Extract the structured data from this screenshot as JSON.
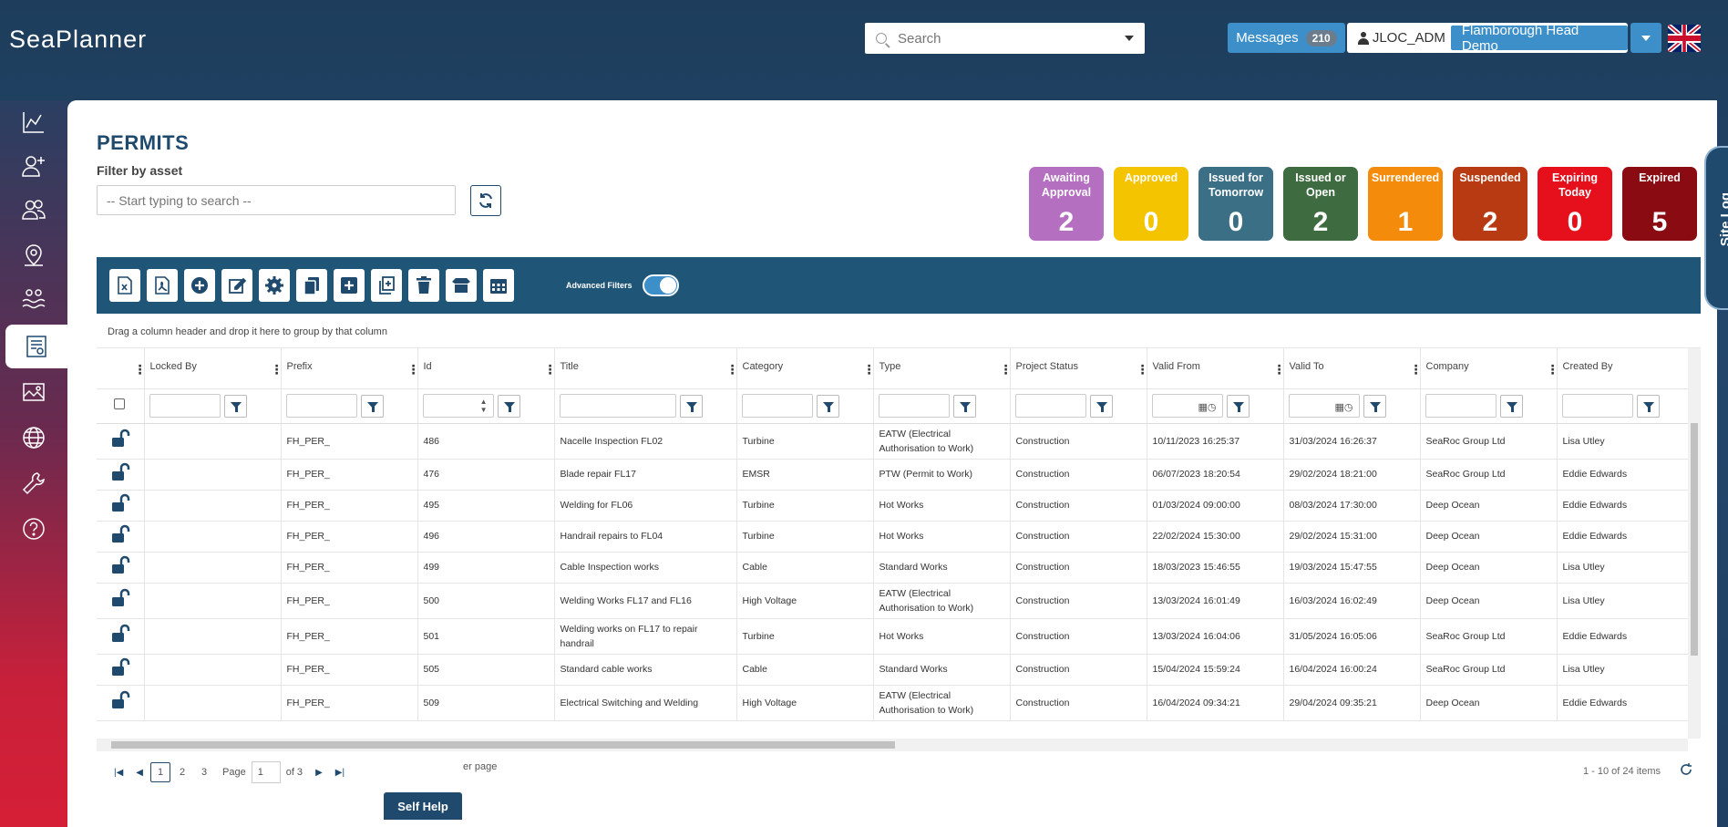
{
  "app": {
    "logo": "SeaPlanner"
  },
  "header": {
    "search_placeholder": "Search",
    "messages_label": "Messages",
    "messages_count": "210",
    "username": "JLOC_ADM",
    "site_name": "Flamborough Head Demo"
  },
  "sidebar": {
    "items": [
      {
        "icon": "chart-line-icon"
      },
      {
        "icon": "add-user-icon"
      },
      {
        "icon": "users-icon"
      },
      {
        "icon": "map-pin-icon"
      },
      {
        "icon": "waves-icon"
      },
      {
        "icon": "permits-icon",
        "active": true
      },
      {
        "icon": "image-icon"
      },
      {
        "icon": "globe-icon"
      },
      {
        "icon": "wrench-icon"
      },
      {
        "icon": "help-icon"
      }
    ]
  },
  "page": {
    "title": "PERMITS",
    "filter_label": "Filter by asset",
    "asset_placeholder": "-- Start typing to search --"
  },
  "status_tiles": [
    {
      "label": "Awaiting Approval",
      "count": "2",
      "color": "#b46fc0"
    },
    {
      "label": "Approved",
      "count": "0",
      "color": "#f5c400"
    },
    {
      "label": "Issued for Tomorrow",
      "count": "0",
      "color": "#3b6f86"
    },
    {
      "label": "Issued or Open",
      "count": "2",
      "color": "#3e6b3f"
    },
    {
      "label": "Surrendered",
      "count": "1",
      "color": "#f58b0a"
    },
    {
      "label": "Suspended",
      "count": "2",
      "color": "#b83a12"
    },
    {
      "label": "Expiring Today",
      "count": "0",
      "color": "#e5101c"
    },
    {
      "label": "Expired",
      "count": "5",
      "color": "#8a0b12"
    }
  ],
  "site_log_label": "Site Log",
  "toolbar": {
    "advanced_filters_label": "Advanced Filters"
  },
  "grid": {
    "group_hint": "Drag a column header and drop it here to group by that column",
    "columns": [
      "Locked By",
      "Prefix",
      "Id",
      "Title",
      "Category",
      "Type",
      "Project Status",
      "Valid From",
      "Valid To",
      "Company",
      "Created By"
    ],
    "rows": [
      {
        "locked_by": "",
        "prefix": "FH_PER_",
        "id": "486",
        "title": "Nacelle Inspection FL02",
        "category": "Turbine",
        "type": "EATW (Electrical Authorisation to Work)",
        "status": "Construction",
        "valid_from": "10/11/2023 16:25:37",
        "valid_to": "31/03/2024 16:26:37",
        "company": "SeaRoc Group Ltd",
        "created_by": "Lisa Utley"
      },
      {
        "locked_by": "",
        "prefix": "FH_PER_",
        "id": "476",
        "title": "Blade repair FL17",
        "category": "EMSR",
        "type": "PTW (Permit to Work)",
        "status": "Construction",
        "valid_from": "06/07/2023 18:20:54",
        "valid_to": "29/02/2024 18:21:00",
        "company": "SeaRoc Group Ltd",
        "created_by": "Eddie Edwards"
      },
      {
        "locked_by": "",
        "prefix": "FH_PER_",
        "id": "495",
        "title": "Welding for FL06",
        "category": "Turbine",
        "type": "Hot Works",
        "status": "Construction",
        "valid_from": "01/03/2024 09:00:00",
        "valid_to": "08/03/2024 17:30:00",
        "company": "Deep Ocean",
        "created_by": "Eddie Edwards"
      },
      {
        "locked_by": "",
        "prefix": "FH_PER_",
        "id": "496",
        "title": "Handrail repairs to FL04",
        "category": "Turbine",
        "type": "Hot Works",
        "status": "Construction",
        "valid_from": "22/02/2024 15:30:00",
        "valid_to": "29/02/2024 15:31:00",
        "company": "Deep Ocean",
        "created_by": "Eddie Edwards"
      },
      {
        "locked_by": "",
        "prefix": "FH_PER_",
        "id": "499",
        "title": "Cable Inspection works",
        "category": "Cable",
        "type": "Standard Works",
        "status": "Construction",
        "valid_from": "18/03/2023 15:46:55",
        "valid_to": "19/03/2024 15:47:55",
        "company": "Deep Ocean",
        "created_by": "Lisa Utley"
      },
      {
        "locked_by": "",
        "prefix": "FH_PER_",
        "id": "500",
        "title": "Welding Works FL17 and FL16",
        "category": "High Voltage",
        "type": "EATW (Electrical Authorisation to Work)",
        "status": "Construction",
        "valid_from": "13/03/2024 16:01:49",
        "valid_to": "16/03/2024 16:02:49",
        "company": "Deep Ocean",
        "created_by": "Lisa Utley"
      },
      {
        "locked_by": "",
        "prefix": "FH_PER_",
        "id": "501",
        "title": "Welding works on FL17 to repair handrail",
        "category": "Turbine",
        "type": "Hot Works",
        "status": "Construction",
        "valid_from": "13/03/2024 16:04:06",
        "valid_to": "31/05/2024 16:05:06",
        "company": "SeaRoc Group Ltd",
        "created_by": "Eddie Edwards"
      },
      {
        "locked_by": "",
        "prefix": "FH_PER_",
        "id": "505",
        "title": "Standard cable works",
        "category": "Cable",
        "type": "Standard Works",
        "status": "Construction",
        "valid_from": "15/04/2024 15:59:24",
        "valid_to": "16/04/2024 16:00:24",
        "company": "SeaRoc Group Ltd",
        "created_by": "Lisa Utley"
      },
      {
        "locked_by": "",
        "prefix": "FH_PER_",
        "id": "509",
        "title": "Electrical Switching and Welding",
        "category": "High Voltage",
        "type": "EATW (Electrical Authorisation to Work)",
        "status": "Construction",
        "valid_from": "16/04/2024 09:34:21",
        "valid_to": "29/04/2024 09:35:21",
        "company": "Deep Ocean",
        "created_by": "Eddie Edwards"
      }
    ]
  },
  "pager": {
    "pages": [
      "1",
      "2",
      "3"
    ],
    "current_page": "1",
    "page_label": "Page",
    "of_label": "of 3",
    "per_page_label": "er page",
    "items_info": "1 - 10 of 24 items"
  },
  "self_help_label": "Self Help",
  "colors": {
    "brand": "#1f4a6e",
    "accent": "#3d8fc9"
  }
}
